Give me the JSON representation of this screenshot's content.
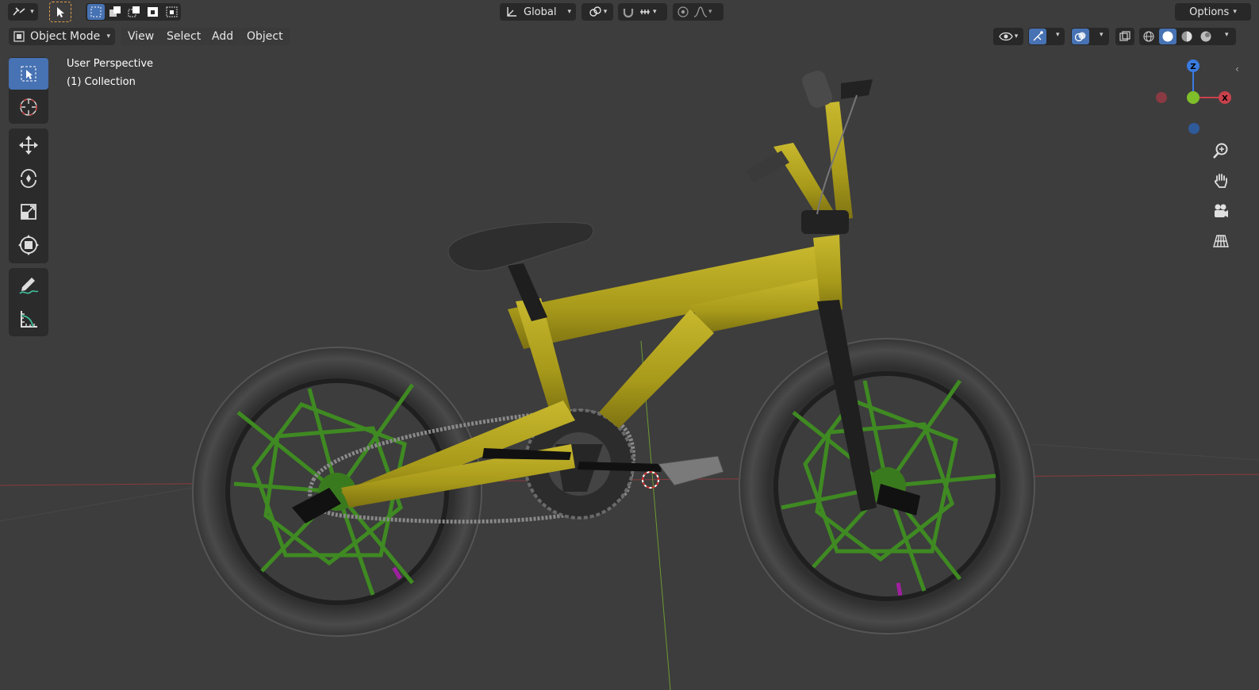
{
  "header": {
    "editor_type_icon": "editor-type-icon",
    "transform_orientation": "Global",
    "options_label": "Options"
  },
  "menubar": {
    "mode": "Object Mode",
    "items": [
      "View",
      "Select",
      "Add",
      "Object"
    ]
  },
  "viewport": {
    "perspective_label": "User Perspective",
    "collection_label": "(1) Collection"
  },
  "gizmo": {
    "z_label": "Z",
    "x_label": "X",
    "y_label": "Y"
  },
  "toolbar": {
    "tools": [
      "select-box",
      "cursor",
      "move",
      "rotate",
      "scale",
      "transform",
      "annotate",
      "measure"
    ],
    "active_tool": "select-box"
  },
  "colors": {
    "accent": "#4772b3",
    "frame": "#b3a41f",
    "spokes": "#3d7a1f",
    "tire": "#3a3a3a",
    "axis_x": "#c8414b",
    "axis_y": "#7fbf2a",
    "axis_z": "#3a7be0"
  }
}
